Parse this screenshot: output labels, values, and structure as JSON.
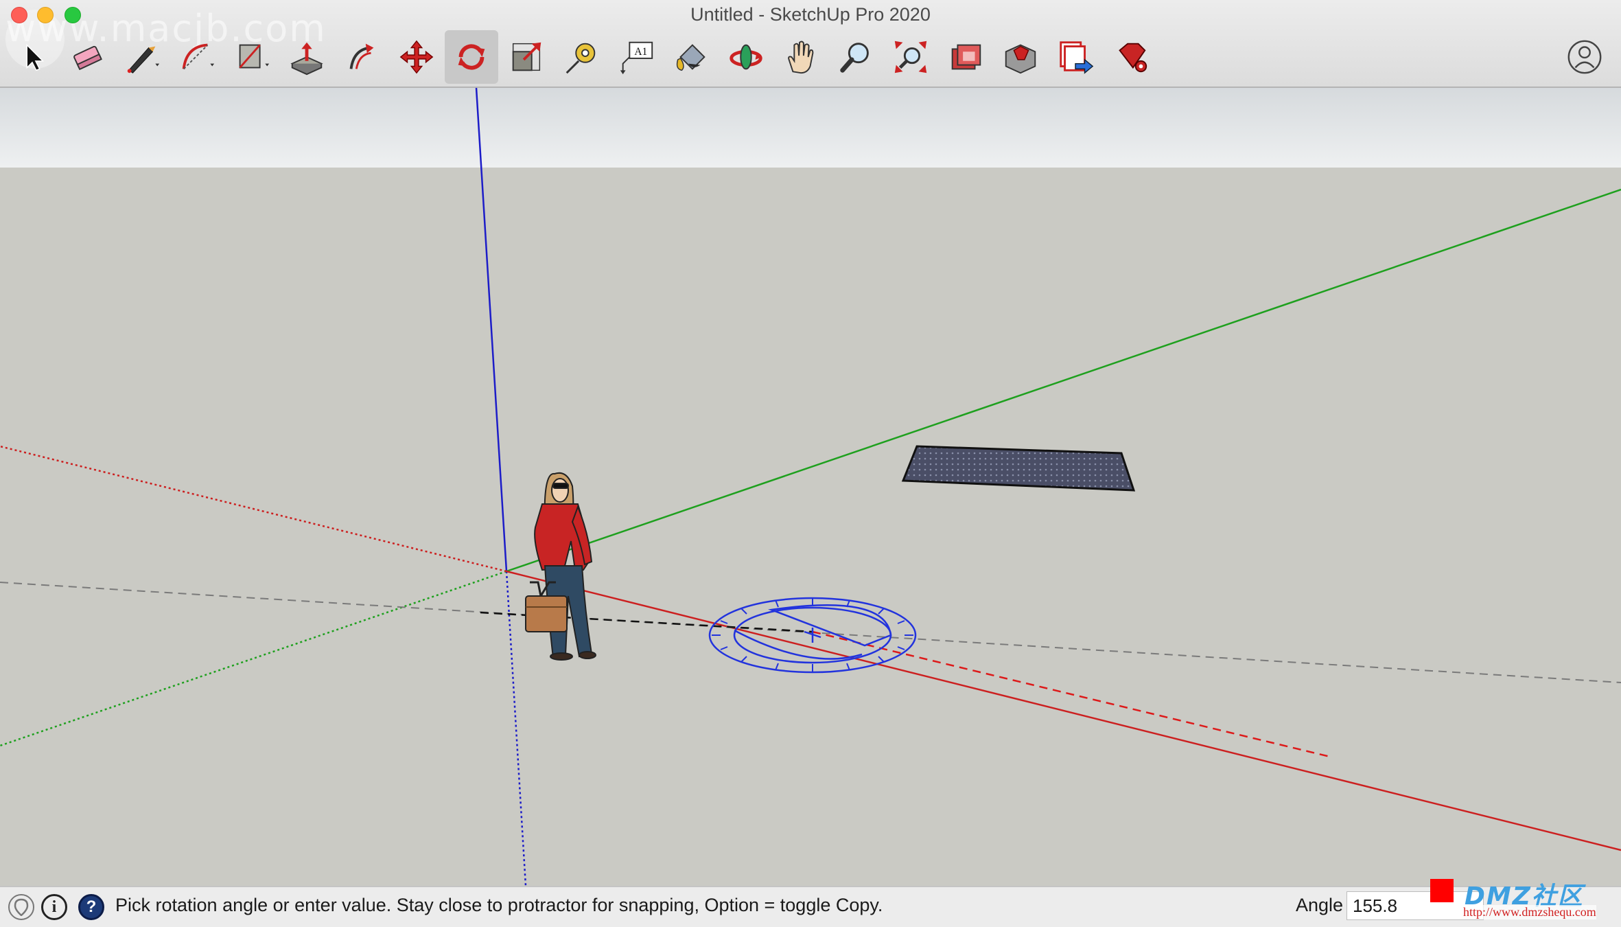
{
  "window": {
    "title": "Untitled - SketchUp Pro 2020",
    "watermark": "www.macjb.com"
  },
  "toolbar": {
    "tools": [
      {
        "name": "select-tool-icon"
      },
      {
        "name": "eraser-tool-icon"
      },
      {
        "name": "line-tool-icon"
      },
      {
        "name": "arc-tool-icon"
      },
      {
        "name": "rectangle-tool-icon"
      },
      {
        "name": "push-pull-tool-icon"
      },
      {
        "name": "offset-tool-icon"
      },
      {
        "name": "move-tool-icon"
      },
      {
        "name": "rotate-tool-icon",
        "active": true
      },
      {
        "name": "scale-tool-icon"
      },
      {
        "name": "tape-measure-tool-icon"
      },
      {
        "name": "text-tool-icon",
        "text": "A1"
      },
      {
        "name": "paint-bucket-tool-icon"
      },
      {
        "name": "orbit-tool-icon"
      },
      {
        "name": "pan-tool-icon"
      },
      {
        "name": "zoom-tool-icon"
      },
      {
        "name": "zoom-extents-tool-icon"
      },
      {
        "name": "warehouse-tool-icon"
      },
      {
        "name": "extension-warehouse-tool-icon"
      },
      {
        "name": "send-to-layout-tool-icon"
      },
      {
        "name": "extension-manager-tool-icon"
      }
    ],
    "account_icon": "account-icon"
  },
  "colors": {
    "axis_red": "#cc1f1f",
    "axis_green": "#1ea01e",
    "axis_blue": "#1c1cc8",
    "protractor": "#2233dd",
    "ground": "#cacac4",
    "sky": "#e8eaeb"
  },
  "statusbar": {
    "message": "Pick rotation angle or enter value.  Stay close to protractor for snapping, Option = toggle Copy.",
    "measure_label": "Angle",
    "measure_value": "155.8",
    "icons": [
      "geo-location-icon",
      "credits-icon",
      "help-icon"
    ]
  },
  "overlay": {
    "site_logo": "DMZ社区",
    "site_url": "http://www.dmzshequ.com"
  }
}
